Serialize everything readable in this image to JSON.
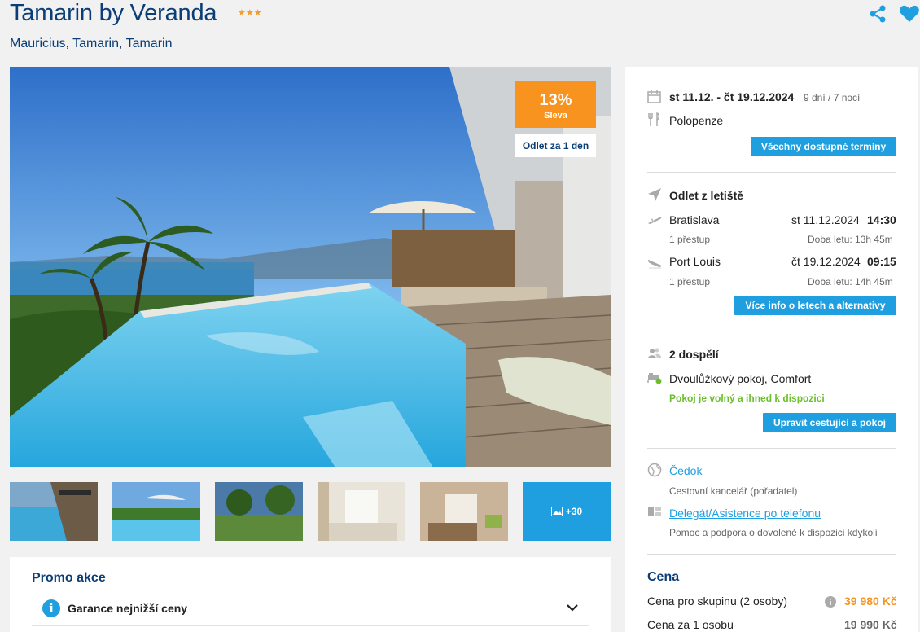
{
  "hotel": {
    "name": "Tamarin by Veranda",
    "stars": "★★★",
    "location": "Mauricius, Tamarin, Tamarin"
  },
  "badges": {
    "discount_pct": "13%",
    "discount_label": "Sleva",
    "departure": "Odlet za 1 den"
  },
  "gallery": {
    "more_label": "+30"
  },
  "promo": {
    "title": "Promo akce",
    "items": [
      {
        "label": "Garance nejnižší ceny"
      }
    ]
  },
  "trip": {
    "dates": "st 11.12. - čt 19.12.2024",
    "duration": "9 dní / 7 nocí",
    "board": "Polopenze",
    "all_dates_button": "Všechny dostupné termíny"
  },
  "flights": {
    "heading": "Odlet z letiště",
    "outbound": {
      "from": "Bratislava",
      "date": "st 11.12.2024",
      "time": "14:30",
      "stops": "1 přestup",
      "duration": "Doba letu: 13h 45m"
    },
    "inbound": {
      "from": "Port Louis",
      "date": "čt 19.12.2024",
      "time": "09:15",
      "stops": "1 přestup",
      "duration": "Doba letu: 14h 45m"
    },
    "more_info_button": "Více info o letech a alternativy"
  },
  "travelers": {
    "count": "2 dospělí",
    "room": "Dvoulůžkový pokoj, Comfort",
    "availability": "Pokoj je volný a ihned k dispozici",
    "edit_button": "Upravit cestující a pokoj"
  },
  "agency": {
    "name": "Čedok",
    "description": "Cestovní kancelář (pořadatel)",
    "support_link": "Delegát/Asistence po telefonu",
    "support_description": "Pomoc a podpora o dovolené k dispozici kdykoli"
  },
  "price": {
    "heading": "Cena",
    "group_label": "Cena pro skupinu (2 osoby)",
    "group_value": "39 980 Kč",
    "per_person_label": "Cena za 1 osobu",
    "per_person_value": "19 990 Kč"
  },
  "colors": {
    "brand_blue": "#0b3e76",
    "accent_blue": "#1f9fe0",
    "orange": "#f7931e",
    "green": "#6cbf2c"
  }
}
